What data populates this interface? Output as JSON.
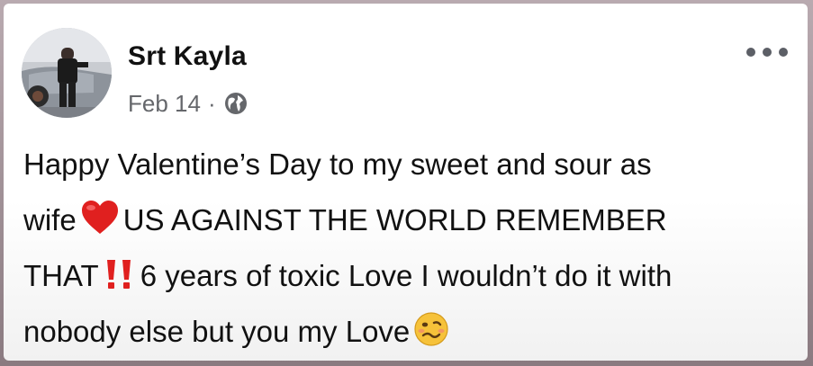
{
  "post": {
    "author": "Srt Kayla",
    "date": "Feb 14",
    "separator": "·",
    "privacy_icon": "globe-icon",
    "more_icon": "more-options-icon",
    "lines": {
      "l1": "Happy Valentine’s Day to my sweet and sour as",
      "l2a": "wife",
      "l2b": "US AGAINST THE WORLD REMEMBER",
      "l3a": "THAT",
      "l3b": "6 years of toxic Love I wouldn’t do it with",
      "l4": "nobody else but you my Love"
    },
    "emojis": [
      "red-heart-emoji",
      "double-exclamation-emoji",
      "woozy-face-emoji"
    ]
  },
  "colors": {
    "card_bg": "#ffffff",
    "secondary_text": "#65676b",
    "heart": "#e0201f",
    "emoji_face": "#f6c23a"
  }
}
